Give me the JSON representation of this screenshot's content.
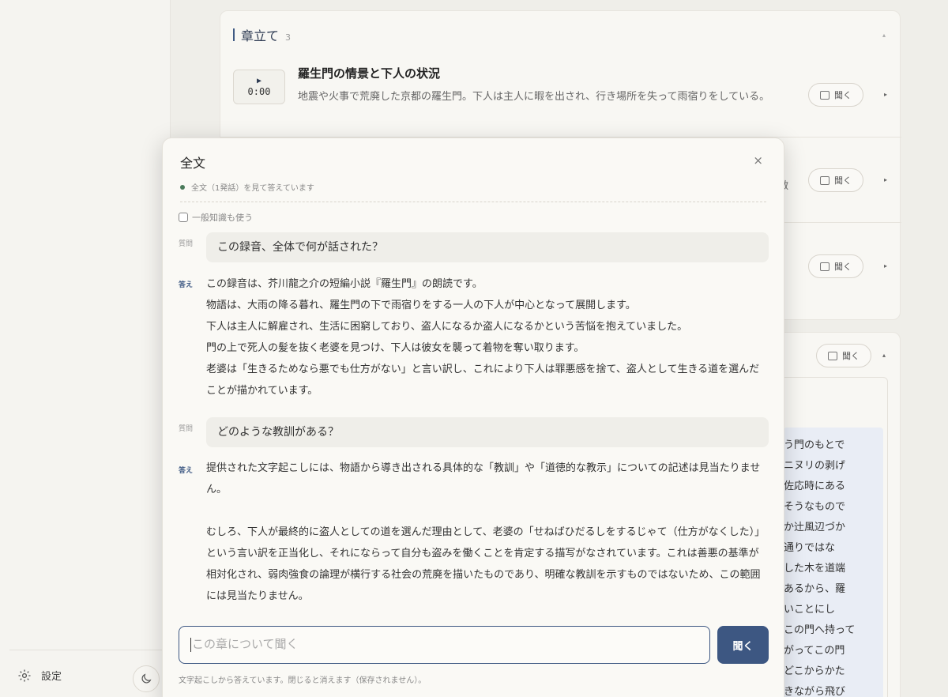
{
  "sidebar": {
    "settings_label": "設定",
    "settings_icon": "gear-icon",
    "theme_icon": "moon-icon"
  },
  "chapters": {
    "title": "章立て",
    "count": "3",
    "items": [
      {
        "time": "0:00",
        "title": "羅生門の情景と下人の状況",
        "description": "地震や火事で荒廃した京都の羅生門。下人は主人に暇を出され、行き場所を失って雨宿りをしている。",
        "ask_label": "聞く"
      },
      {
        "peek": "敷",
        "ask_label": "聞く"
      },
      {
        "ask_label": "聞く"
      }
    ]
  },
  "lower": {
    "ask_label": "聞く",
    "transcript_lines": [
      "う門のもとで",
      "ニヌリの剥げ",
      "佐応時にある",
      "そうなもので",
      "か辻風辺づか",
      "通りではな",
      "した木を道端",
      "あるから、羅",
      "いことにし",
      "この門へ持って",
      "がってこの門",
      "どこからかた",
      "きながら飛び"
    ]
  },
  "modal": {
    "title": "全文",
    "close": "×",
    "status": "全文（1発話）を見て答えています",
    "general_knowledge": "一般知識も使う",
    "q_label": "質問",
    "a_label": "答え",
    "qa": [
      {
        "question": "この録音、全体で何が話された？",
        "answer": [
          "この録音は、芥川龍之介の短編小説『羅生門』の朗読です。",
          "物語は、大雨の降る暮れ、羅生門の下で雨宿りをする一人の下人が中心となって展開します。",
          "下人は主人に解雇され、生活に困窮しており、盗人になるか盗人になるかという苦悩を抱えていました。",
          "門の上で死人の髪を抜く老婆を見つけ、下人は彼女を襲って着物を奪い取ります。",
          "老婆は「生きるためなら悪でも仕方がない」と言い訳し、これにより下人は罪悪感を捨て、盗人として生きる道を選んだことが描かれています。"
        ]
      },
      {
        "question": "どのような教訓がある？",
        "answer": [
          "提供された文字起こしには、物語から導き出される具体的な「教訓」や「道徳的な教示」についての記述は見当たりません。",
          "",
          "むしろ、下人が最終的に盗人としての道を選んだ理由として、老婆の「せねばひだるしをするじゃて（仕方がなくした）」という言い訳を正当化し、それにならって自分も盗みを働くことを肯定する描写がなされています。これは善悪の基準が相対化され、弱肉強食の論理が横行する社会の荒廃を描いたものであり、明確な教訓を示すものではないため、この範囲には見当たりません。"
        ]
      }
    ],
    "input_placeholder": "この章について聞く",
    "send_label": "聞く",
    "footnote": "文字起こしから答えています。閉じると消えます（保存されません）。"
  }
}
